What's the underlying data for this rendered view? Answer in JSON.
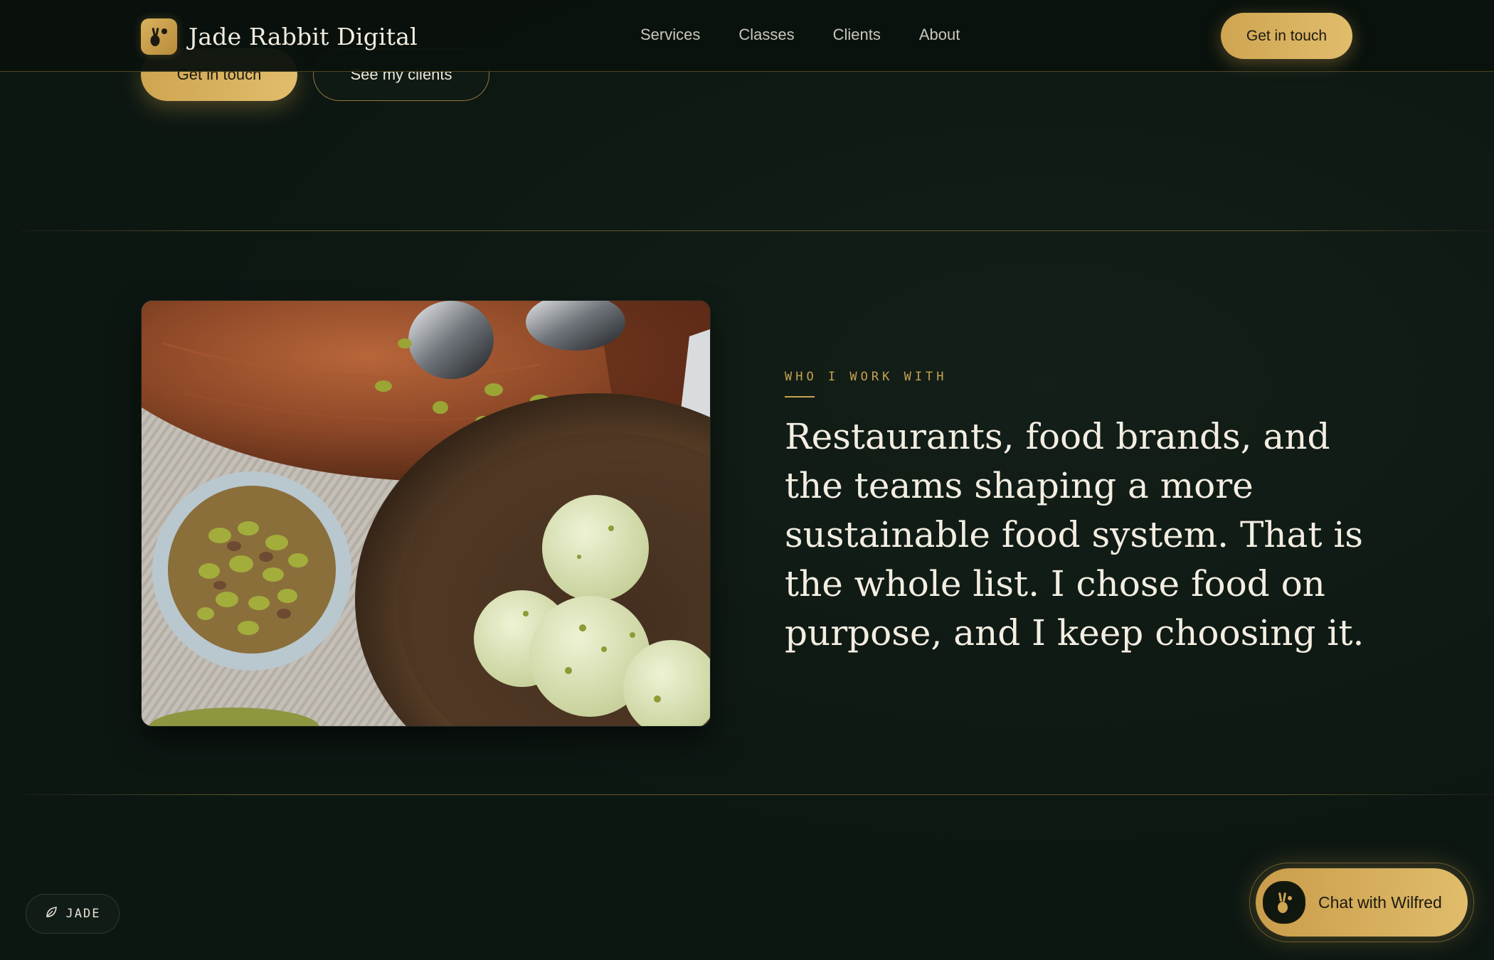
{
  "header": {
    "brand_name": "Jade Rabbit Digital",
    "brand_icon": "rabbit-logo-icon",
    "nav": [
      {
        "label": "Services"
      },
      {
        "label": "Classes"
      },
      {
        "label": "Clients"
      },
      {
        "label": "About"
      }
    ],
    "cta_label": "Get in touch"
  },
  "hero": {
    "primary_button": "Get in touch",
    "secondary_button": "See my clients"
  },
  "section": {
    "image_alt": "Bowl of pistachio ice cream with a dish of pistachios on a wooden board",
    "eyebrow": "WHO I WORK WITH",
    "body": "Restaurants, food brands, and the teams shaping a more sustainable food system. That is the whole list. I chose food on purpose, and I keep choosing it."
  },
  "widgets": {
    "jade_badge_label": "JADE",
    "jade_badge_icon": "leaf-icon",
    "chat_label": "Chat with Wilfred",
    "chat_icon": "rabbit-avatar-icon"
  },
  "colors": {
    "background": "#0d1712",
    "accent_gold": "#c9a250",
    "text_primary": "#f3eee2",
    "nav_text": "#c9c6bc"
  }
}
